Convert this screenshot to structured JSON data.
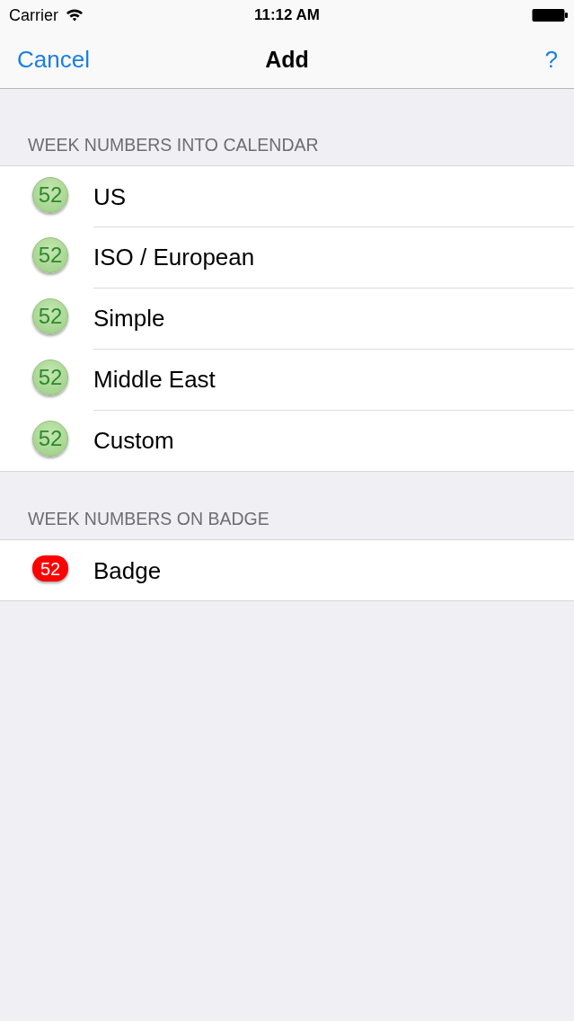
{
  "status_bar": {
    "carrier": "Carrier",
    "time": "11:12 AM"
  },
  "nav_bar": {
    "left_button": "Cancel",
    "title": "Add",
    "right_button": "?"
  },
  "sections": [
    {
      "header": "WEEK NUMBERS INTO CALENDAR",
      "items": [
        {
          "kind": "circle",
          "number": "52",
          "label": "US"
        },
        {
          "kind": "circle",
          "number": "52",
          "label": "ISO / European"
        },
        {
          "kind": "circle",
          "number": "52",
          "label": "Simple"
        },
        {
          "kind": "circle",
          "number": "52",
          "label": "Middle East"
        },
        {
          "kind": "circle",
          "number": "52",
          "label": "Custom"
        }
      ]
    },
    {
      "header": "WEEK NUMBERS ON BADGE",
      "items": [
        {
          "kind": "pill",
          "number": "52",
          "label": "Badge"
        }
      ]
    }
  ]
}
